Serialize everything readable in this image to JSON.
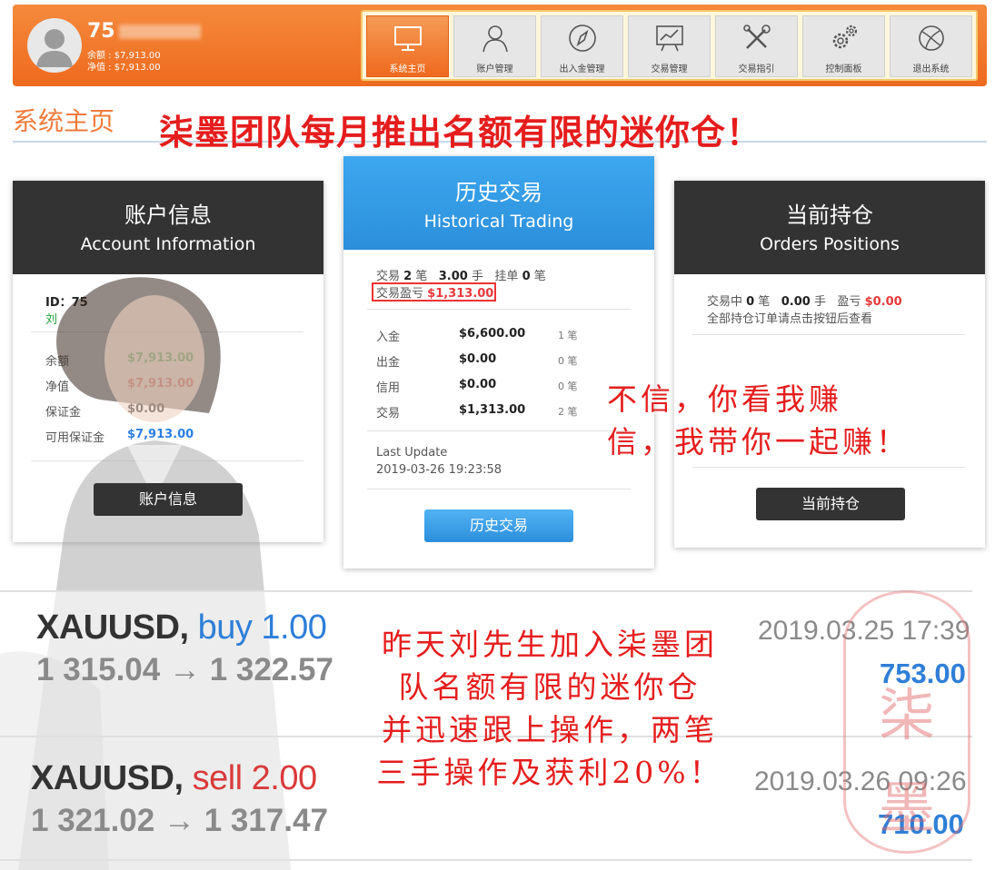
{
  "header": {
    "user_id": "75",
    "balance_line": "余额 : $7,913.00",
    "equity_line": "净值 : $7,913.00"
  },
  "nav": {
    "items": [
      {
        "label": "系统主页",
        "icon": "monitor-icon",
        "active": true
      },
      {
        "label": "账户管理",
        "icon": "user-icon",
        "active": false
      },
      {
        "label": "出入金管理",
        "icon": "compass-icon",
        "active": false
      },
      {
        "label": "交易管理",
        "icon": "chart-board-icon",
        "active": false
      },
      {
        "label": "交易指引",
        "icon": "tools-icon",
        "active": false
      },
      {
        "label": "控制面板",
        "icon": "gears-icon",
        "active": false
      },
      {
        "label": "退出系统",
        "icon": "globe-icon",
        "active": false
      }
    ]
  },
  "page_title": "系统主页",
  "promo_banner": "柒墨团队每月推出名额有限的迷你仓！",
  "account_card": {
    "title_cn": "账户信息",
    "title_en": "Account Information",
    "id_line": "ID：75",
    "name": "刘",
    "rows": [
      {
        "label": "余额",
        "value": "$7,913.00",
        "color": "#22a13a"
      },
      {
        "label": "净值",
        "value": "$7,913.00",
        "color": "#e8383a"
      },
      {
        "label": "保证金",
        "value": "$0.00",
        "color": "#222222"
      },
      {
        "label": "可用保证金",
        "value": "$7,913.00",
        "color": "#2b7fe0"
      }
    ],
    "button": "账户信息"
  },
  "history_card": {
    "title_cn": "历史交易",
    "title_en": "Historical Trading",
    "line1_a": "交易",
    "line1_count": "2",
    "line1_b": "笔",
    "line1_lots": "3.00",
    "line1_c": "手",
    "line1_d": "挂单",
    "line1_pending": "0",
    "line1_e": "笔",
    "pl_label": "交易盈亏",
    "pl_value": "$1,313.00",
    "rows": [
      {
        "label": "入金",
        "value": "$6,600.00",
        "count": "1 笔"
      },
      {
        "label": "出金",
        "value": "$0.00",
        "count": "0 笔"
      },
      {
        "label": "信用",
        "value": "$0.00",
        "count": "0 笔"
      },
      {
        "label": "交易",
        "value": "$1,313.00",
        "count": "2 笔"
      }
    ],
    "last_update_label": "Last Update",
    "last_update": "2019-03-26 19:23:58",
    "button": "历史交易"
  },
  "positions_card": {
    "title_cn": "当前持仓",
    "title_en": "Orders Positions",
    "line1_a": "交易中",
    "line1_count": "0",
    "line1_b": "笔",
    "line1_lots": "0.00",
    "line1_c": "手",
    "line1_d": "盈亏",
    "line1_pl": "$0.00",
    "line2": "全部持仓订单请点击按钮后查看",
    "button": "当前持仓"
  },
  "overlay_text_right": [
    "不信，你看我赚",
    "信，我带你一起赚！"
  ],
  "overlay_text_bottom": [
    "昨天刘先生加入柒墨团",
    "队名额有限的迷你仓",
    "并迅速跟上操作，两笔",
    "三手操作及获利20%！"
  ],
  "trades": [
    {
      "symbol": "XAUUSD,",
      "direction": "buy 1.00",
      "side": "buy",
      "prices": "1 315.04 → 1 322.57",
      "time": "2019.03.25 17:39",
      "profit": "753.00"
    },
    {
      "symbol": "XAUUSD,",
      "direction": "sell 2.00",
      "side": "sell",
      "prices": "1 321.02 → 1 317.47",
      "time": "2019.03.26 09:26",
      "profit": "710.00"
    }
  ],
  "stamp_chars": [
    "柒",
    "墨"
  ]
}
